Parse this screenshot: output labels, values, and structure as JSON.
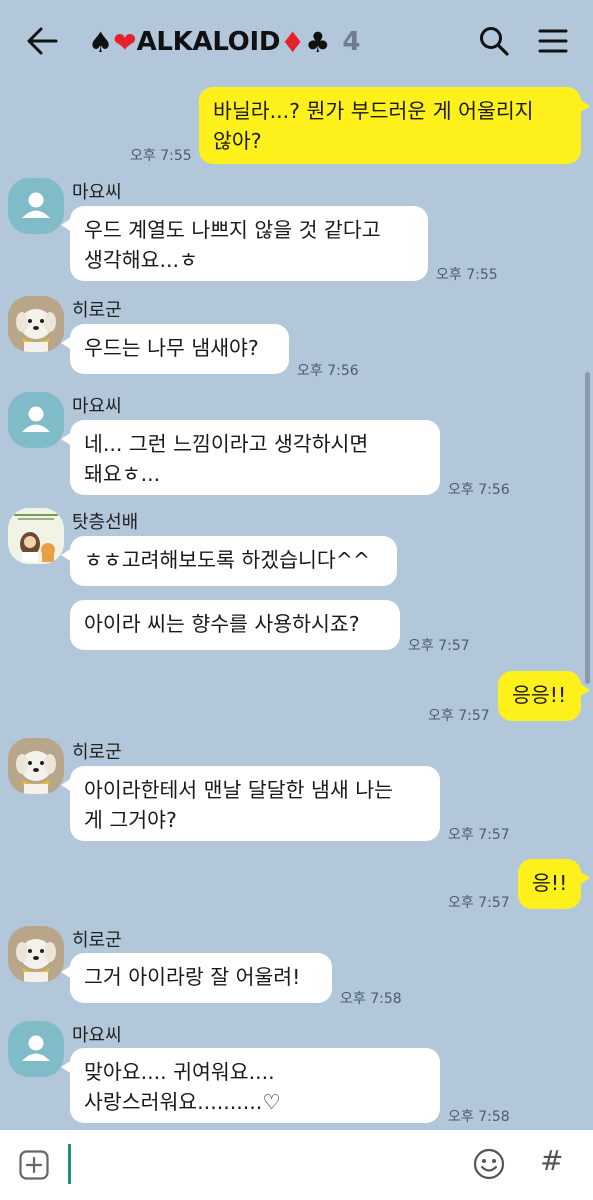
{
  "header": {
    "suit_prefix_1": "♠",
    "suit_prefix_2": "❤",
    "room_name": "ALKALOID",
    "suit_suffix_1": "♦",
    "suit_suffix_2": "♣",
    "member_count": "4"
  },
  "icons": [
    "back-arrow-icon",
    "search-icon",
    "menu-icon",
    "plus-icon",
    "emoji-icon",
    "hash-icon"
  ],
  "colors": {
    "chat_bg": "#b2c7d9",
    "my_bubble": "#fef01b",
    "other_bubble": "#ffffff"
  },
  "messages": [
    {
      "type": "out",
      "text_1": "바닐라...? 뭔가 부드러운 게 어울리지",
      "text_2": "않아?",
      "time": "오후 7:55"
    },
    {
      "type": "in",
      "sender": "마요씨",
      "text_1": "우드 계열도 나쁘지 않을 것 같다고",
      "text_2": "생각해요...ㅎ",
      "time": "오후 7:55"
    },
    {
      "type": "in",
      "sender": "히로군",
      "text_1": "우드는 나무 냄새야?",
      "time": "오후 7:56"
    },
    {
      "type": "in",
      "sender": "마요씨",
      "text_1": "네... 그런 느낌이라고 생각하시면",
      "text_2": "돼요ㅎ...",
      "time": "오후 7:56"
    },
    {
      "type": "in",
      "sender": "탓층선배",
      "text_1": "ㅎㅎ고려해보도록 하겠습니다^^"
    },
    {
      "type": "in",
      "text_1": "아이라 씨는 향수를 사용하시죠?",
      "time": "오후 7:57"
    },
    {
      "type": "out",
      "text_1": "응응!!",
      "time": "오후 7:57"
    },
    {
      "type": "in",
      "sender": "히로군",
      "text_1": "아이라한테서 맨날 달달한 냄새 나는",
      "text_2": "게 그거야?",
      "time": "오후 7:57"
    },
    {
      "type": "out",
      "text_1": "응!!",
      "time": "오후 7:57"
    },
    {
      "type": "in",
      "sender": "히로군",
      "text_1": "그거 아이라랑 잘 어울려!",
      "time": "오후 7:58"
    },
    {
      "type": "in",
      "sender": "마요씨",
      "text_1": "맞아요.... 귀여워요....",
      "text_2": "사랑스러워요..........♡",
      "time": "오후 7:58"
    }
  ],
  "input": {
    "hash_label": "#"
  }
}
